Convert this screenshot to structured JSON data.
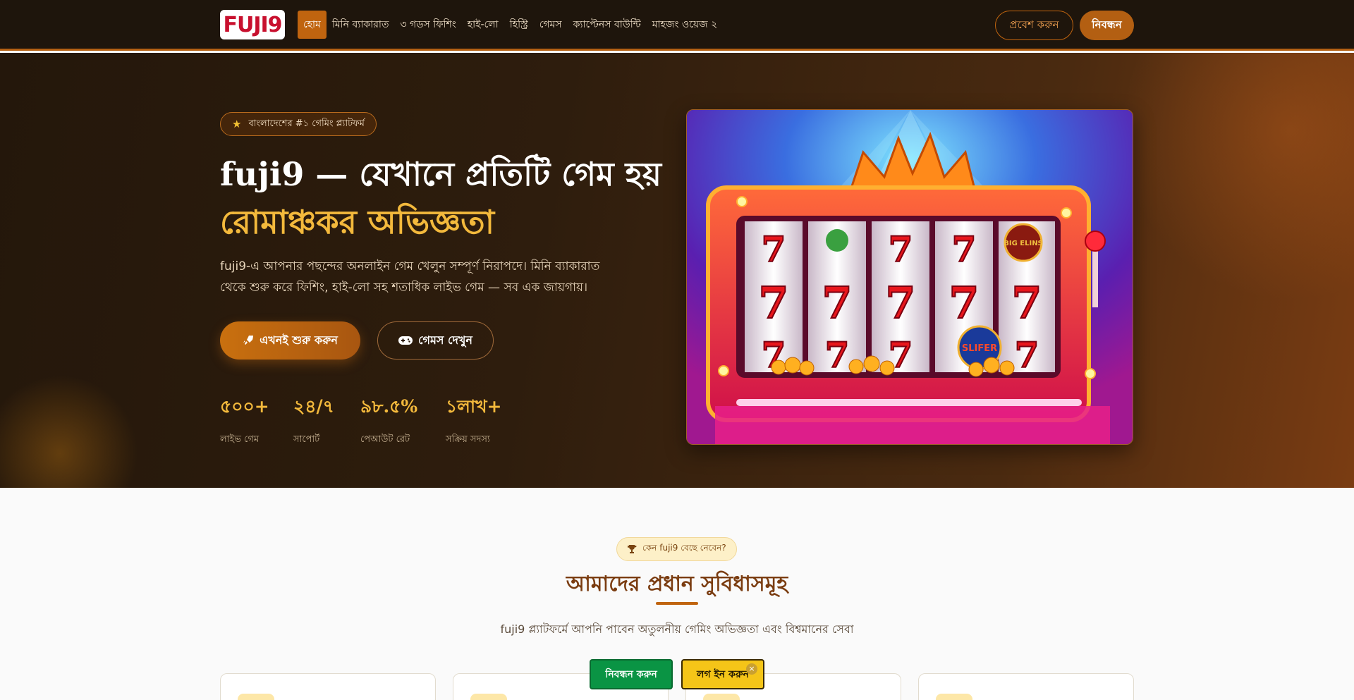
{
  "nav": {
    "logo": "FUJI9",
    "links": [
      {
        "label": "হোম"
      },
      {
        "label": "মিনি ব্যাকারাত"
      },
      {
        "label": "৩ গডস ফিশিং"
      },
      {
        "label": "হাই-লো"
      },
      {
        "label": "হিস্ট্রি"
      },
      {
        "label": "গেমস"
      },
      {
        "label": "ক্যাপ্টেনস বাউন্টি"
      },
      {
        "label": "মাহজং ওয়েজ ২"
      }
    ],
    "login_label": "প্রবেশ করুন",
    "register_label": "নিবন্ধন"
  },
  "hero": {
    "badge": "বাংলাদেশের #১ গেমিং প্ল্যাটফর্ম",
    "title_line1": "fuji9 — যেখানে প্রতিটি গেম হয়",
    "title_line2": "রোমাঞ্চকর অভিজ্ঞতা",
    "description": "fuji9-এ আপনার পছন্দের অনলাইন গেম খেলুন সম্পূর্ণ নিরাপদে। মিনি ব্যাকারাত থেকে শুরু করে ফিশিং, হাই-লো সহ শতাধিক লাইভ গেম — সব এক জায়গায়।",
    "cta_primary": "এখনই শুরু করুন",
    "cta_secondary": "গেমস দেখুন",
    "stats": [
      {
        "value": "৫০০+",
        "label": "লাইভ গেম"
      },
      {
        "value": "২৪/৭",
        "label": "সাপোর্ট"
      },
      {
        "value": "৯৮.৫%",
        "label": "পেআউট রেট"
      },
      {
        "value": "১লাখ+",
        "label": "সক্রিয় সদস্য"
      }
    ],
    "slot_symbols": [
      "7",
      "7",
      "7",
      "7",
      "7"
    ],
    "slot_labels": [
      "SLIFER",
      "BIG ELINS"
    ]
  },
  "features": {
    "pill": "কেন fuji9 বেছে নেবেন?",
    "title": "আমাদের প্রধান সুবিধাসমূহ",
    "subtitle": "fuji9 প্ল্যাটফর্মে আপনি পাবেন অতুলনীয় গেমিং অভিজ্ঞতা এবং বিশ্বমানের সেবা"
  },
  "floating": {
    "register": "নিবন্ধন করুন",
    "login": "লগ ইন করুন",
    "close": "×"
  },
  "colors": {
    "accent": "#c0640f",
    "gold": "#f3b93c",
    "nav_bg": "#1e150c",
    "green": "#0a9444",
    "yellow": "#f5c518"
  }
}
